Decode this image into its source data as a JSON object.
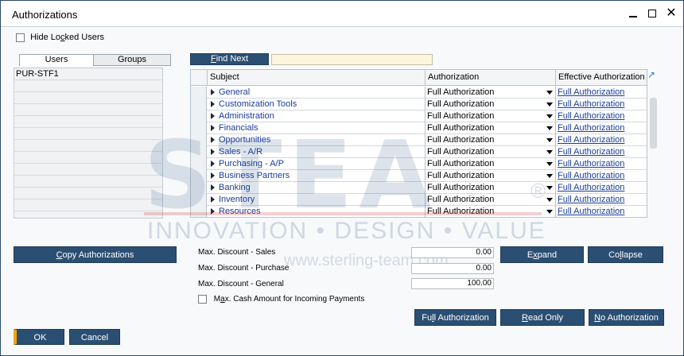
{
  "window": {
    "title": "Authorizations"
  },
  "controls": {
    "minimize": "—",
    "maximize": "□",
    "close": "✕"
  },
  "hide_locked": {
    "label_pre": "Hide Lo",
    "label_key": "c",
    "label_post": "ked Users",
    "checked": false
  },
  "tabs": [
    {
      "label": "Users"
    },
    {
      "label": "Groups"
    }
  ],
  "users": [
    "PUR-STF1"
  ],
  "find": {
    "label_key": "F",
    "label_rest": "ind Next",
    "value": ""
  },
  "grid": {
    "headers": [
      "Subject",
      "Authorization",
      "Effective Authorization"
    ],
    "rows": [
      {
        "subject": "General",
        "authorization": "Full Authorization",
        "effective": "Full Authorization"
      },
      {
        "subject": "Customization Tools",
        "authorization": "Full Authorization",
        "effective": "Full Authorization"
      },
      {
        "subject": "Administration",
        "authorization": "Full Authorization",
        "effective": "Full Authorization"
      },
      {
        "subject": "Financials",
        "authorization": "Full Authorization",
        "effective": "Full Authorization"
      },
      {
        "subject": "Opportunities",
        "authorization": "Full Authorization",
        "effective": "Full Authorization"
      },
      {
        "subject": "Sales - A/R",
        "authorization": "Full Authorization",
        "effective": "Full Authorization"
      },
      {
        "subject": "Purchasing - A/P",
        "authorization": "Full Authorization",
        "effective": "Full Authorization"
      },
      {
        "subject": "Business Partners",
        "authorization": "Full Authorization",
        "effective": "Full Authorization"
      },
      {
        "subject": "Banking",
        "authorization": "Full Authorization",
        "effective": "Full Authorization"
      },
      {
        "subject": "Inventory",
        "authorization": "Full Authorization",
        "effective": "Full Authorization"
      },
      {
        "subject": "Resources",
        "authorization": "Full Authorization",
        "effective": "Full Authorization"
      }
    ]
  },
  "watermark": {
    "brand": "STEA",
    "registered": "®",
    "tagline": "INNOVATION • DESIGN • VALUE",
    "url": "www.sterling-team.com"
  },
  "fields": {
    "max_discount_sales": {
      "label": "Max. Discount - Sales",
      "value": "0.00"
    },
    "max_discount_purchase": {
      "label": "Max. Discount - Purchase",
      "value": "0.00"
    },
    "max_discount_general": {
      "label": "Max. Discount - General",
      "value": "100.00"
    }
  },
  "cash": {
    "label_key": "a",
    "label_pre": "M",
    "label_post": "x. Cash Amount for Incoming Payments",
    "checked": false
  },
  "buttons": {
    "copy": {
      "pre": "",
      "key": "C",
      "post": "opy Authorizations"
    },
    "expand": {
      "pre": "E",
      "key": "x",
      "post": "pand"
    },
    "collapse": {
      "pre": "Co",
      "key": "l",
      "post": "lapse"
    },
    "full": {
      "pre": "Fu",
      "key": "l",
      "post": "l Authorization"
    },
    "read_only": {
      "pre": "",
      "key": "R",
      "post": "ead Only"
    },
    "no_auth": {
      "pre": "",
      "key": "N",
      "post": "o Authorization"
    },
    "ok": "OK",
    "cancel": "Cancel"
  }
}
